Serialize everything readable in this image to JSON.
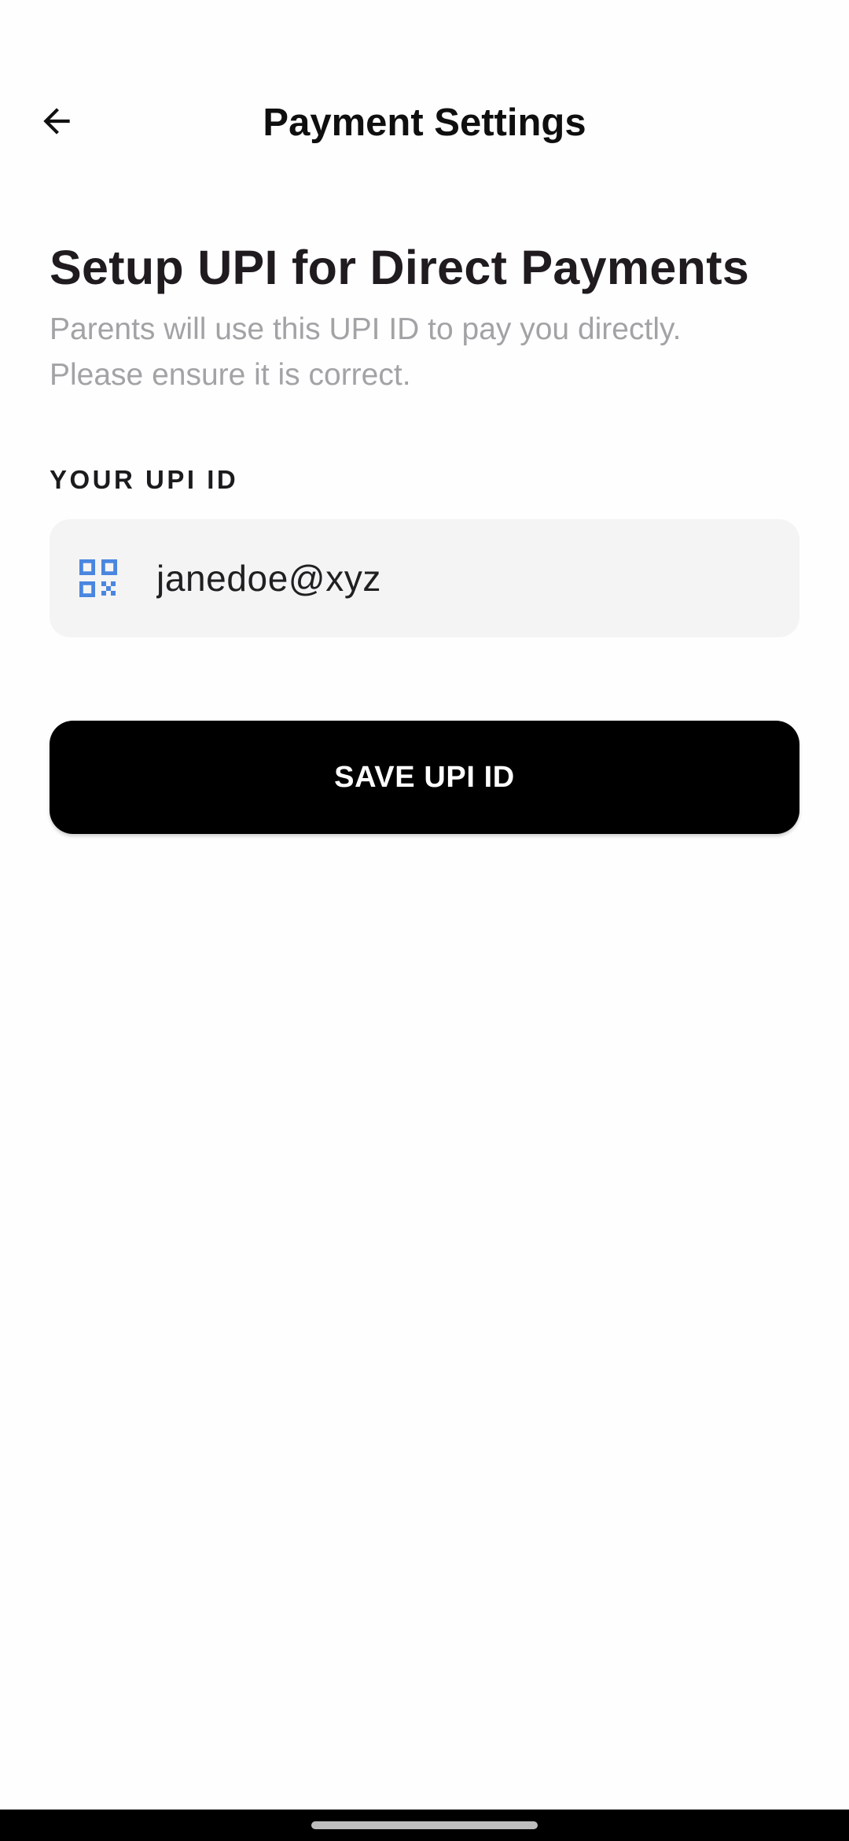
{
  "header": {
    "title": "Payment Settings",
    "back_icon": "arrow-left-icon"
  },
  "main": {
    "heading": "Setup UPI for Direct Payments",
    "subtitle": "Parents will use this UPI ID to pay you directly. Please ensure it is correct.",
    "field_label": "YOUR UPI ID",
    "upi_input": {
      "value": "janedoe@xyz",
      "icon": "qr-code-icon",
      "icon_color": "#4a86e0"
    },
    "save_button_label": "SAVE UPI ID"
  },
  "colors": {
    "button_bg": "#000000",
    "input_bg": "#f4f4f4",
    "subtitle_text": "#a3a3a6"
  }
}
